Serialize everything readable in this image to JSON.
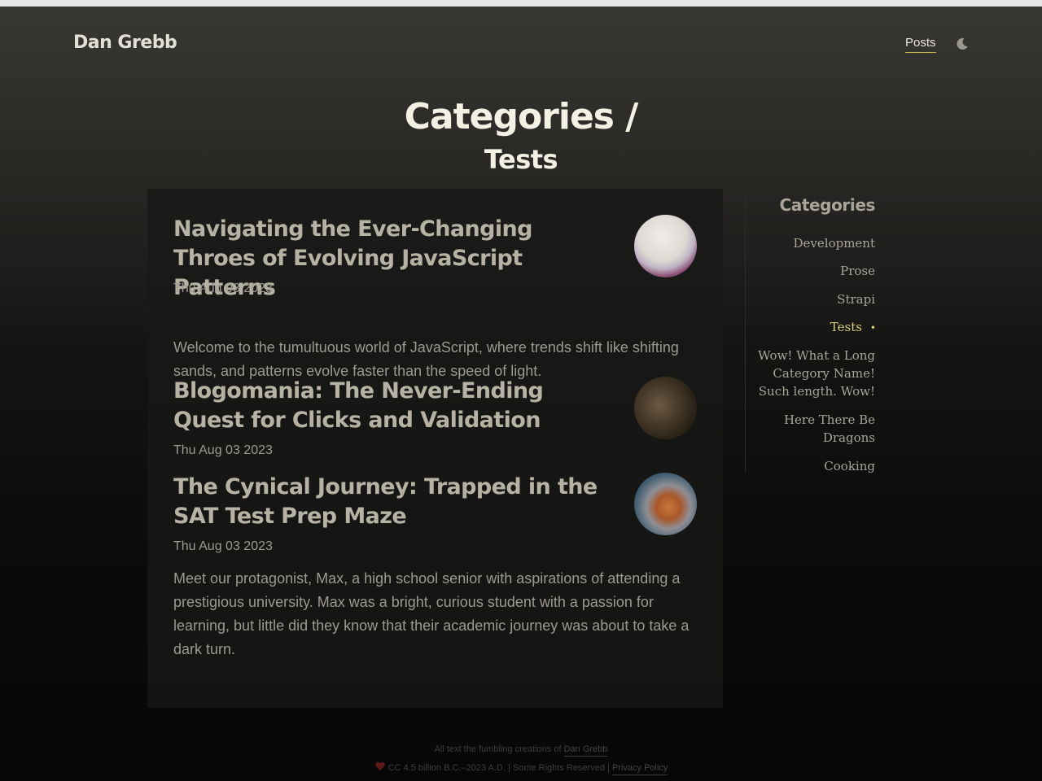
{
  "header": {
    "site_title": "Dan Grebb",
    "nav_posts": "Posts",
    "theme_toggle_icon": "moon-icon"
  },
  "page": {
    "heading_line1": "Categories /",
    "heading_line2": "Tests"
  },
  "posts": [
    {
      "title": "Navigating the Ever-Changing Throes of Evolving JavaScript Patterns",
      "date": "Thu Aug 03 2023",
      "excerpt": "Welcome to the tumultuous world of JavaScript, where trends shift like shifting sands, and patterns evolve faster than the speed of light.",
      "thumb_icon": "post-thumbnail-abstract"
    },
    {
      "title": "Blogomania: The Never-Ending Quest for Clicks and Validation",
      "date": "Thu Aug 03 2023",
      "excerpt": "",
      "thumb_icon": "post-thumbnail-machinery"
    },
    {
      "title": "The Cynical Journey: Trapped in the SAT Test Prep Maze",
      "date": "Thu Aug 03 2023",
      "excerpt": "Meet our protagonist, Max, a high school senior with aspirations of attending a prestigious university. Max was a bright, curious student with a passion for learning, but little did they know that their academic journey was about to take a dark turn.",
      "thumb_icon": "post-thumbnail-gears"
    }
  ],
  "sidebar": {
    "title": "Categories",
    "items": [
      {
        "label": "Development",
        "active": false
      },
      {
        "label": "Prose",
        "active": false
      },
      {
        "label": "Strapi",
        "active": false
      },
      {
        "label": "Tests",
        "active": true
      },
      {
        "label": "Wow! What a Long Category Name! Such length. Wow!",
        "active": false
      },
      {
        "label": "Here There Be Dragons",
        "active": false
      },
      {
        "label": "Cooking",
        "active": false
      }
    ],
    "active_marker": "•"
  },
  "footer": {
    "line1_prefix": "All text the fumbling creations of",
    "line1_link": "Dan Grebb",
    "line2_text": "CC 4.5 billion B.C.–2023 A.D. | Some Rights Reserved |",
    "line2_link": "Privacy Policy",
    "heart_icon": "heart-icon"
  },
  "colors": {
    "accent": "#c8b44c",
    "active_category": "#d9cf7a"
  }
}
